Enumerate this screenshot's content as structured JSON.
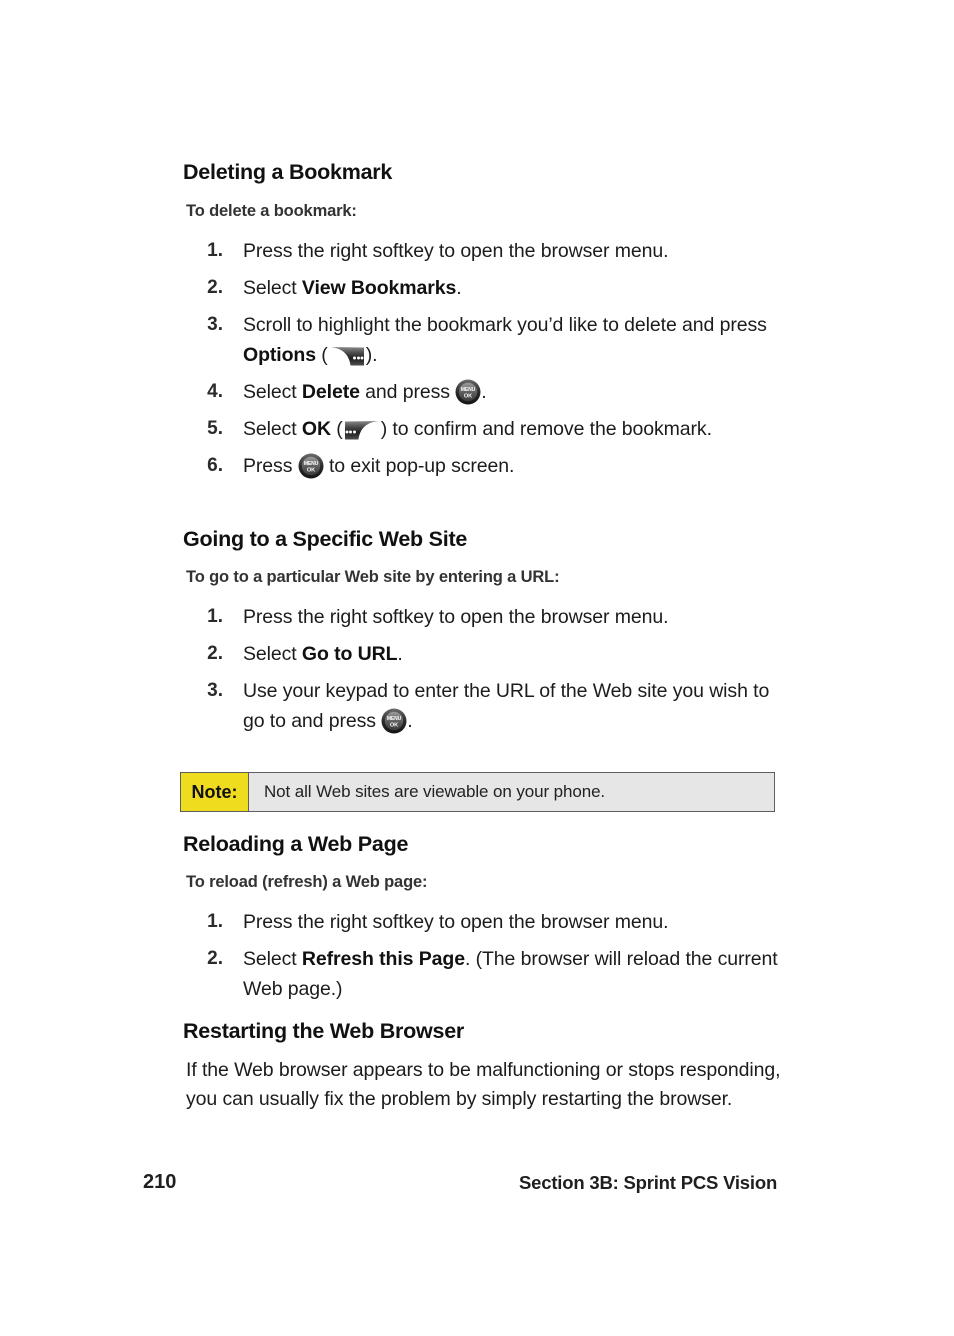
{
  "page": {
    "number": "210",
    "section_footer": "Section 3B: Sprint PCS Vision"
  },
  "colors": {
    "note_label_bg": "#f0dc1e",
    "note_body_bg": "#e6e6e6",
    "note_border": "#5e5e5e",
    "text": "#1c1c1c"
  },
  "sections": [
    {
      "heading": "Deleting a Bookmark",
      "subheading": "To delete a bookmark:",
      "steps": [
        {
          "num": "1.",
          "pre": "Press the right softkey to open the browser menu.",
          "bold": "",
          "post": "",
          "icon": ""
        },
        {
          "num": "2.",
          "pre": "Select ",
          "bold": "View Bookmarks",
          "post": ".",
          "icon": ""
        },
        {
          "num": "3.",
          "pre": "Scroll to highlight the bookmark you’d like to delete and press ",
          "bold": "Options",
          "post": " (",
          "icon": "right-softkey-icon",
          "tail": ")."
        },
        {
          "num": "4.",
          "pre": "Select ",
          "bold": "Delete",
          "post": " and press ",
          "icon": "menu-ok-key-icon",
          "tail": "."
        },
        {
          "num": "5.",
          "pre": "Select ",
          "bold": "OK",
          "post": " (",
          "icon": "left-softkey-icon",
          "tail": ") to confirm and remove the bookmark."
        },
        {
          "num": "6.",
          "pre": "Press ",
          "bold": "",
          "post": "",
          "icon": "menu-ok-key-icon",
          "tail": " to exit pop-up screen."
        }
      ]
    },
    {
      "heading": "Going to a Specific Web Site",
      "subheading": "To go to a particular Web site by entering a URL:",
      "steps": [
        {
          "num": "1.",
          "pre": "Press the right softkey to open the browser menu.",
          "bold": "",
          "post": "",
          "icon": ""
        },
        {
          "num": "2.",
          "pre": "Select ",
          "bold": "Go to URL",
          "post": ".",
          "icon": ""
        },
        {
          "num": "3.",
          "pre": "Use your keypad to enter the URL of the Web site you wish to go to and press ",
          "bold": "",
          "post": "",
          "icon": "menu-ok-key-icon",
          "tail": "."
        }
      ]
    },
    {
      "heading": "Reloading a Web Page",
      "subheading": "To reload (refresh) a Web page:",
      "steps": [
        {
          "num": "1.",
          "pre": "Press the right softkey to open the browser menu.",
          "bold": "",
          "post": "",
          "icon": ""
        },
        {
          "num": "2.",
          "pre": "Select ",
          "bold": "Refresh this Page",
          "post": ". (The browser will reload the current Web page.)",
          "icon": ""
        }
      ]
    },
    {
      "heading": "Restarting the Web Browser",
      "paragraph": "If the Web browser appears to be malfunctioning or stops responding, you can usually fix the problem by simply restarting the browser."
    }
  ],
  "note": {
    "label": "Note:",
    "text": "Not all Web sites are viewable on your phone."
  },
  "icons": {
    "menu_ok_line1": "MENU",
    "menu_ok_line2": "OK"
  }
}
